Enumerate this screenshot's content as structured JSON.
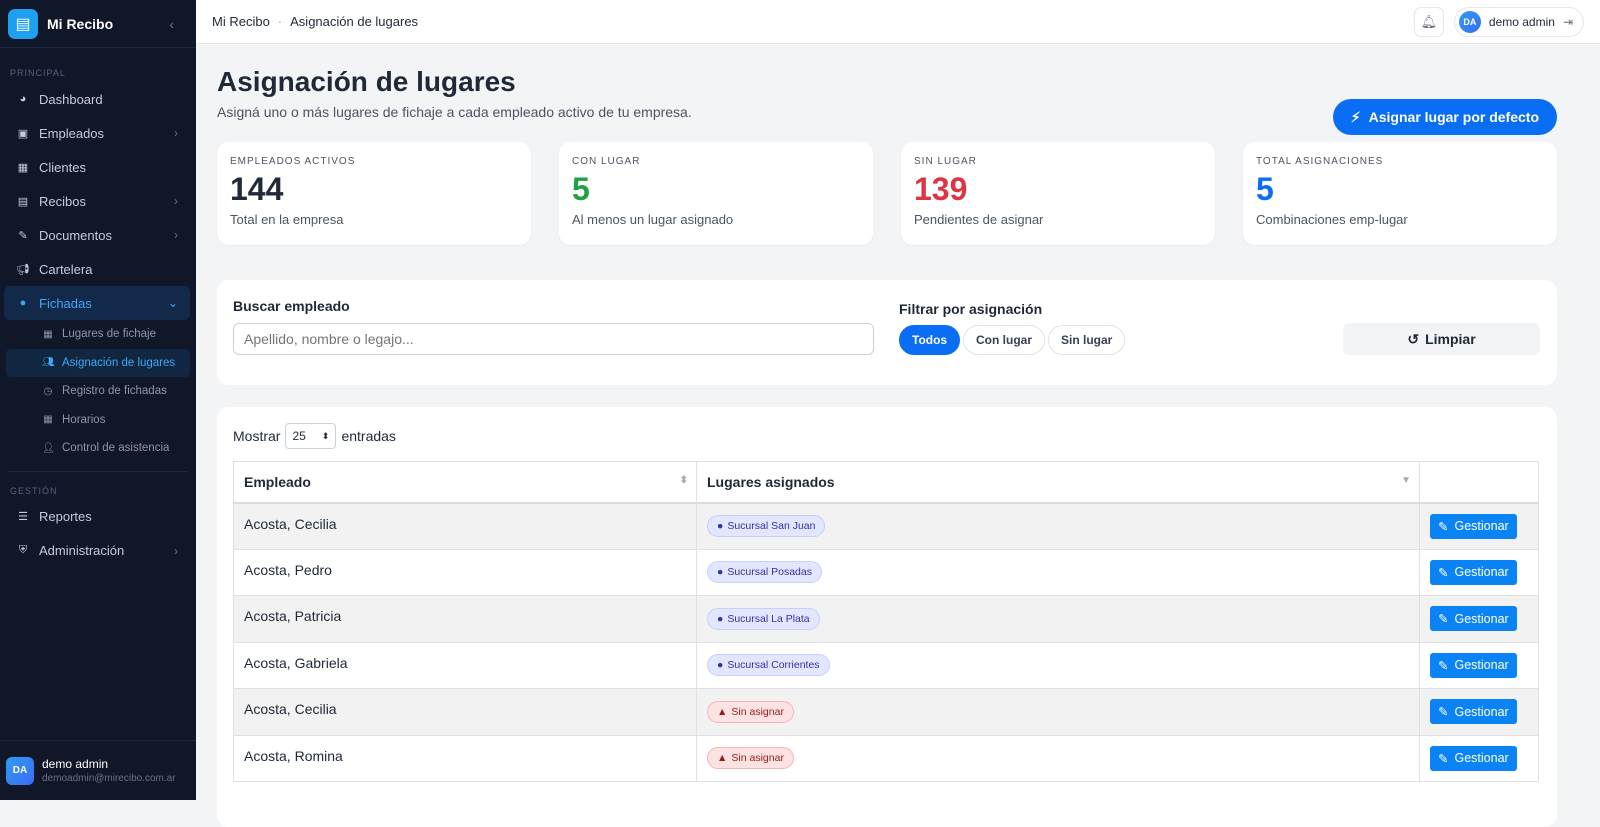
{
  "brand": {
    "name": "Mi Recibo"
  },
  "sidebar": {
    "section_principal": "PRINCIPAL",
    "section_gestion": "GESTIÓN",
    "items": [
      {
        "label": "Dashboard"
      },
      {
        "label": "Empleados"
      },
      {
        "label": "Clientes"
      },
      {
        "label": "Recibos"
      },
      {
        "label": "Documentos"
      },
      {
        "label": "Cartelera"
      },
      {
        "label": "Fichadas"
      }
    ],
    "subitems": [
      {
        "label": "Lugares de fichaje"
      },
      {
        "label": "Asignación de lugares"
      },
      {
        "label": "Registro de fichadas"
      },
      {
        "label": "Horarios"
      },
      {
        "label": "Control de asistencia"
      }
    ],
    "gestion_items": [
      {
        "label": "Reportes"
      },
      {
        "label": "Administración"
      }
    ],
    "user": {
      "initials": "DA",
      "name": "demo admin",
      "email": "demoadmin@mirecibo.com.ar"
    }
  },
  "topbar": {
    "breadcrumb": [
      "Mi Recibo",
      "Asignación de lugares"
    ],
    "user_initials": "DA",
    "user_name": "demo admin"
  },
  "page": {
    "title": "Asignación de lugares",
    "subtitle": "Asigná uno o más lugares de fichaje a cada empleado activo de tu empresa.",
    "primary_button": "Asignar lugar por defecto"
  },
  "stats": [
    {
      "label": "EMPLEADOS ACTIVOS",
      "value": "144",
      "desc": "Total en la empresa",
      "color": "#1f2937"
    },
    {
      "label": "CON LUGAR",
      "value": "5",
      "desc": "Al menos un lugar asignado",
      "color": "#22a045"
    },
    {
      "label": "SIN LUGAR",
      "value": "139",
      "desc": "Pendientes de asignar",
      "color": "#dc3545"
    },
    {
      "label": "TOTAL ASIGNACIONES",
      "value": "5",
      "desc": "Combinaciones emp-lugar",
      "color": "#0a6ef5"
    }
  ],
  "filters": {
    "search_label": "Buscar empleado",
    "search_placeholder": "Apellido, nombre o legajo...",
    "filter_label": "Filtrar por asignación",
    "options": [
      "Todos",
      "Con lugar",
      "Sin lugar"
    ],
    "selected": "Todos",
    "clear": "Limpiar"
  },
  "table": {
    "show_label": "Mostrar",
    "page_size": "25",
    "entries_label": "entradas",
    "columns": [
      "Empleado",
      "Lugares asignados",
      ""
    ],
    "action_label": "Gestionar",
    "rows": [
      {
        "employee": "Acosta, Cecilia",
        "place": "Sucursal San Juan",
        "assigned": true
      },
      {
        "employee": "Acosta, Pedro",
        "place": "Sucursal Posadas",
        "assigned": true
      },
      {
        "employee": "Acosta, Patricia",
        "place": "Sucursal La Plata",
        "assigned": true
      },
      {
        "employee": "Acosta, Gabriela",
        "place": "Sucursal Corrientes",
        "assigned": true
      },
      {
        "employee": "Acosta, Cecilia",
        "place": "Sin asignar",
        "assigned": false
      },
      {
        "employee": "Acosta, Romina",
        "place": "Sin asignar",
        "assigned": false
      }
    ]
  }
}
